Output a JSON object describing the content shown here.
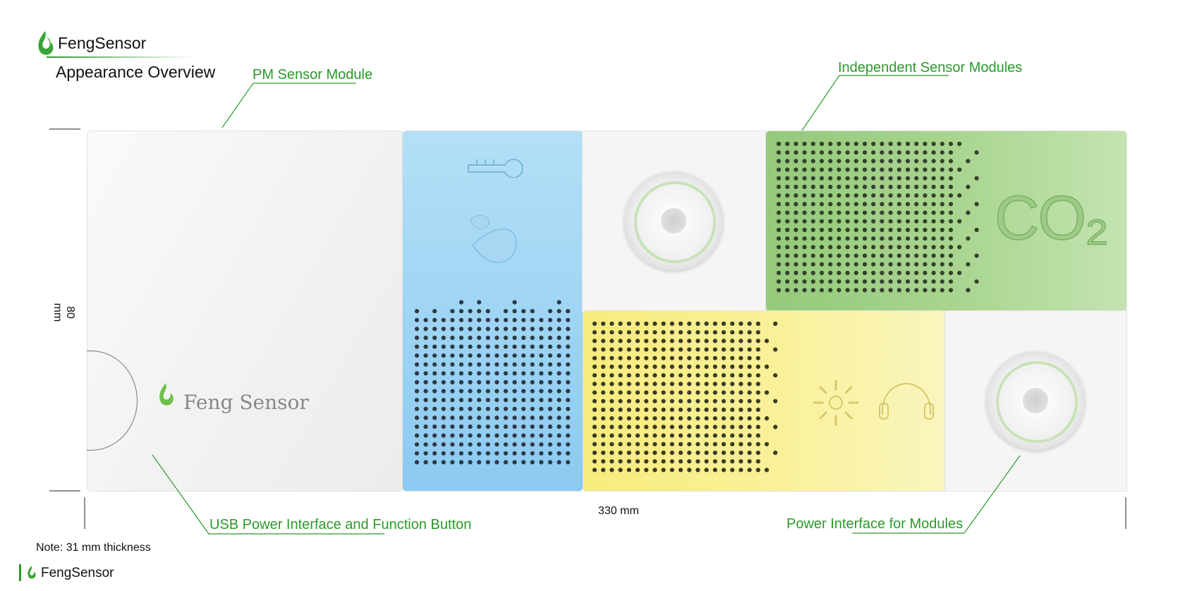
{
  "header": {
    "brand": "FengSensor",
    "subtitle": "Appearance Overview"
  },
  "callouts": {
    "pm_module": "PM Sensor Module",
    "independent_modules": "Independent Sensor Modules",
    "usb_power": "USB Power Interface and Function Button",
    "module_power": "Power Interface for Modules"
  },
  "dimensions": {
    "height": "80 mm",
    "width": "330 mm"
  },
  "note": "Note: 31 mm thickness",
  "device": {
    "logo_text": "Feng Sensor",
    "co2_label": "CO₂"
  },
  "footer": {
    "brand": "FengSensor"
  },
  "colors": {
    "accent_green": "#2b9a2b",
    "pm_blue": "#9fd4f3",
    "co2_green": "#9fd080",
    "env_yellow": "#f8f2a0",
    "shell_white": "#f6f6f6",
    "icons": [
      "thermometer-icon",
      "droplet-icon",
      "sun-icon",
      "headphones-icon",
      "flame-logo-icon"
    ]
  }
}
